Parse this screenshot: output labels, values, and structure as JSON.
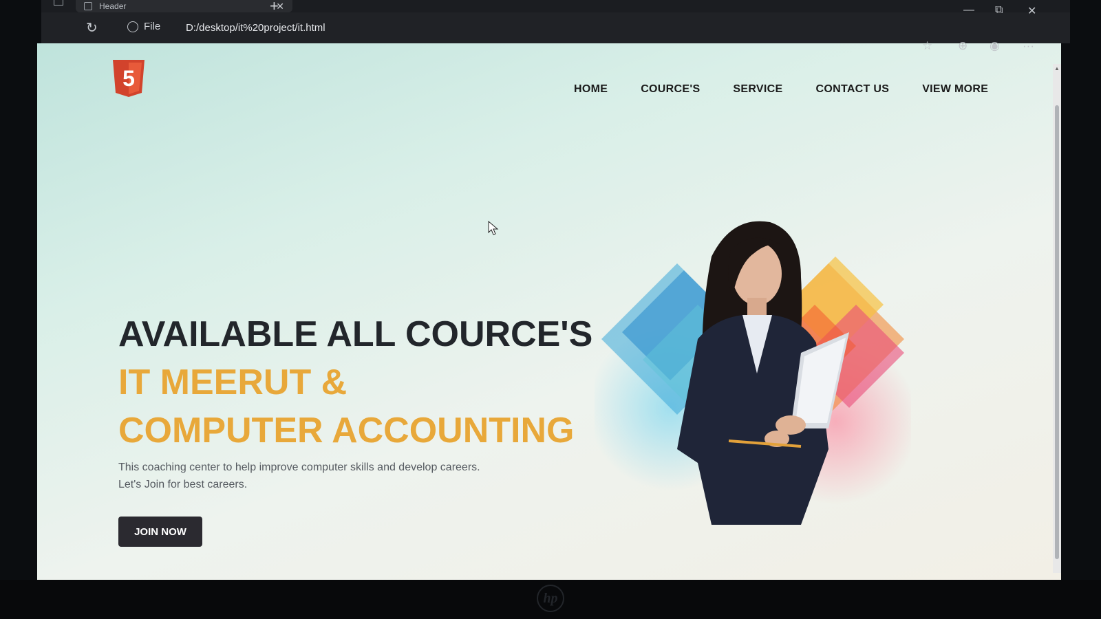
{
  "browser": {
    "tab_title": "Header",
    "tab_close": "✕",
    "new_tab": "+",
    "reload_icon": "↻",
    "scheme_label": "File",
    "url": "D:/desktop/it%20project/it.html",
    "window_controls": {
      "minimize": "—",
      "restore": "⧉",
      "close": "✕"
    },
    "toolbar_icons": {
      "favorites": "☆",
      "collections": "⊕",
      "profile": "◉",
      "more": "···"
    }
  },
  "page": {
    "logo_text": "5",
    "nav": [
      "HOME",
      "COURCE'S",
      "SERVICE",
      "CONTACT US",
      "VIEW MORE"
    ],
    "hero": {
      "line1": "AVAILABLE ALL COURCE'S",
      "line2": "IT MEERUT &",
      "line3": "COMPUTER ACCOUNTING",
      "desc1": "This coaching center to help improve computer skills and develop careers.",
      "desc2": "Let's Join for best careers.",
      "cta": "JOIN NOW"
    }
  },
  "colors": {
    "accent": "#e8a83a",
    "heading": "#22262b",
    "button": "#2b2a30",
    "logo": "#d2432c"
  },
  "monitor_brand": "hp"
}
